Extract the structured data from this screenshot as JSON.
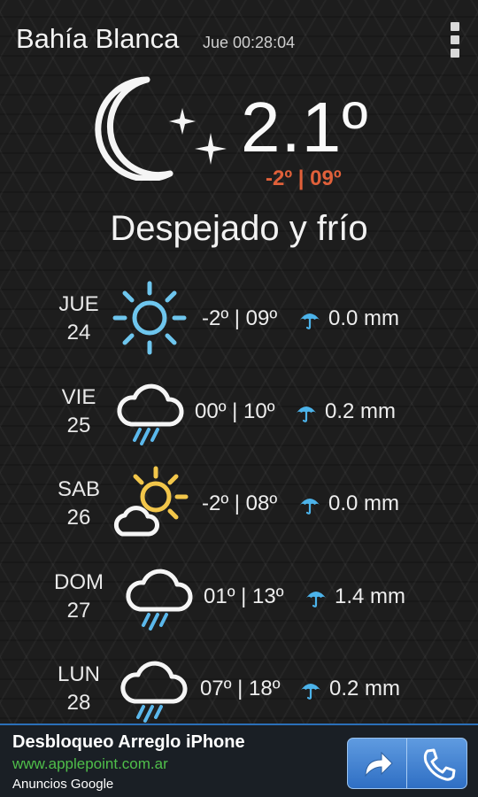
{
  "header": {
    "city": "Bahía Blanca",
    "datetime": "Jue 00:28:04",
    "menu_icon": "overflow-menu-icon"
  },
  "current": {
    "icon": "moon-stars-icon",
    "temperature": "2.1º",
    "range": "-2º | 09º",
    "condition": "Despejado y frío",
    "range_color": "#e0603a"
  },
  "forecast": [
    {
      "day": "JUE",
      "date": "24",
      "icon": "sun-icon",
      "temps": "-2º | 09º",
      "rain": "0.0 mm"
    },
    {
      "day": "VIE",
      "date": "25",
      "icon": "cloud-rain-icon",
      "temps": "00º | 10º",
      "rain": "0.2 mm"
    },
    {
      "day": "SAB",
      "date": "26",
      "icon": "partly-cloudy-icon",
      "temps": "-2º | 08º",
      "rain": "0.0 mm"
    },
    {
      "day": "DOM",
      "date": "27",
      "icon": "cloud-rain-icon",
      "temps": "01º | 13º",
      "rain": "1.4 mm"
    },
    {
      "day": "LUN",
      "date": "28",
      "icon": "cloud-rain-icon",
      "temps": "07º | 18º",
      "rain": "0.2 mm"
    }
  ],
  "ad": {
    "title": "Desbloqueo Arreglo iPhone",
    "url": "www.applepoint.com.ar",
    "source": "Anuncios Google",
    "buttons": [
      "share-arrow-icon",
      "phone-icon"
    ],
    "url_color": "#4fbf4a"
  },
  "colors": {
    "sun": "#6ec6ee",
    "sun_yellow": "#f2c64a",
    "rain": "#5bb8ec",
    "umbrella": "#4cb3ea"
  }
}
